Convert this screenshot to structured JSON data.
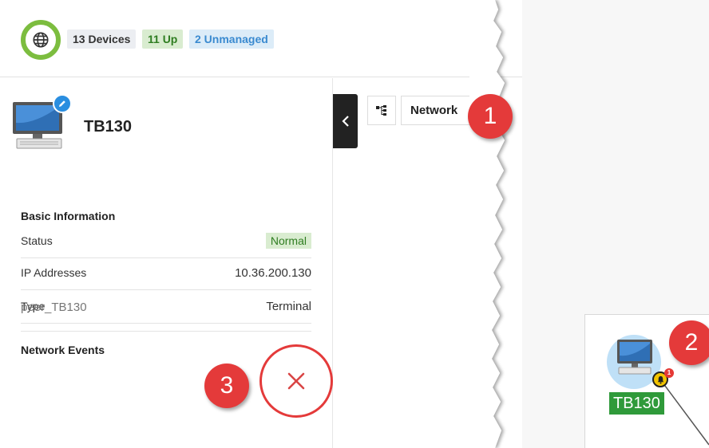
{
  "header": {
    "devices_badge": "13 Devices",
    "up_badge": "11 Up",
    "unmanaged_badge": "2 Unmanaged",
    "globe_icon": "globe-icon",
    "colors": {
      "ring": "#7cbd3f",
      "up": "#2f7d21",
      "unmanaged": "#3a8ad0"
    }
  },
  "device": {
    "name": "TB130",
    "icon": "computer-icon",
    "edit_icon": "pencil-icon"
  },
  "basic_info": {
    "title": "Basic Information",
    "rows": [
      {
        "label": "Status",
        "value": "Normal"
      },
      {
        "label": "IP Addresses",
        "value": "10.36.200.130"
      },
      {
        "label": "Type",
        "value": "Terminal"
      }
    ]
  },
  "network_events": {
    "title": "Network Events",
    "items": [
      {
        "label": "peer_TB130"
      }
    ],
    "close_icon": "close-icon"
  },
  "toolbar": {
    "topology_icon": "topology-tree-icon",
    "network_label": "Network",
    "collapse_icon": "chevron-left-icon"
  },
  "map": {
    "node_label": "TB130",
    "alarm_count": "1",
    "node_icon": "computer-icon",
    "alarm_icon": "bell-icon",
    "colors": {
      "node_label_bg": "#2f9a3a",
      "alarm": "#f2c400"
    }
  },
  "callouts": {
    "one": "1",
    "two": "2",
    "three": "3",
    "color": "#e43a3a"
  }
}
